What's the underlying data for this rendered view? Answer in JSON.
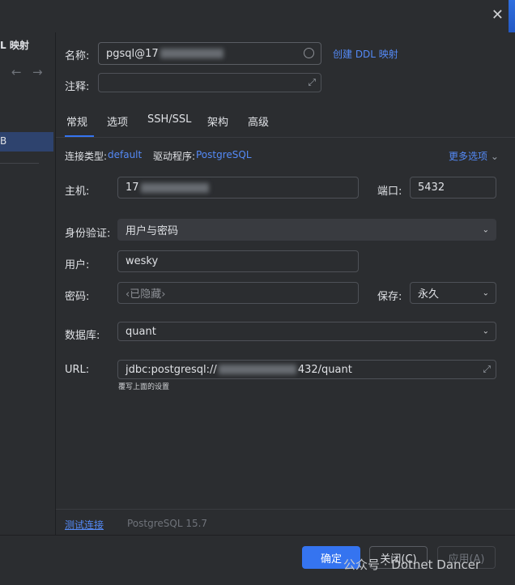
{
  "window": {
    "close_icon": "close-icon"
  },
  "sidebar": {
    "title": "L 映射",
    "back_arrow": "←",
    "forward_arrow": "→",
    "selected_item": "B"
  },
  "header": {
    "name_label": "名称:",
    "name_value_prefix": "pgsql@17",
    "create_ddl_link": "创建 DDL 映射",
    "comment_label": "注释:",
    "comment_value": ""
  },
  "tabs": [
    {
      "label": "常规",
      "active": true
    },
    {
      "label": "选项",
      "active": false
    },
    {
      "label": "SSH/SSL",
      "active": false
    },
    {
      "label": "架构",
      "active": false
    },
    {
      "label": "高级",
      "active": false
    }
  ],
  "connection": {
    "type_label": "连接类型:",
    "type_value": "default",
    "driver_label": "驱动程序:",
    "driver_value": "PostgreSQL",
    "more_options": "更多选项"
  },
  "form": {
    "host_label": "主机:",
    "host_value_prefix": "17",
    "port_label": "端口:",
    "port_value": "5432",
    "auth_label": "身份验证:",
    "auth_value": "用户与密码",
    "user_label": "用户:",
    "user_value": "wesky",
    "password_label": "密码:",
    "password_placeholder": "‹已隐藏›",
    "save_label": "保存:",
    "save_value": "永久",
    "database_label": "数据库:",
    "database_value": "quant",
    "url_label": "URL:",
    "url_prefix": "jdbc:postgresql://",
    "url_suffix": "432/quant",
    "url_hint": "覆写上面的设置"
  },
  "footer": {
    "test_connection": "测试连接",
    "driver_version": "PostgreSQL 15.7"
  },
  "buttons": {
    "ok": "确定",
    "close": "关闭(C)",
    "apply": "应用(A)"
  },
  "watermark": "公众号 · Dotnet Dancer",
  "colors": {
    "accent": "#3574f0",
    "link": "#548af7",
    "background": "#2b2d30"
  }
}
